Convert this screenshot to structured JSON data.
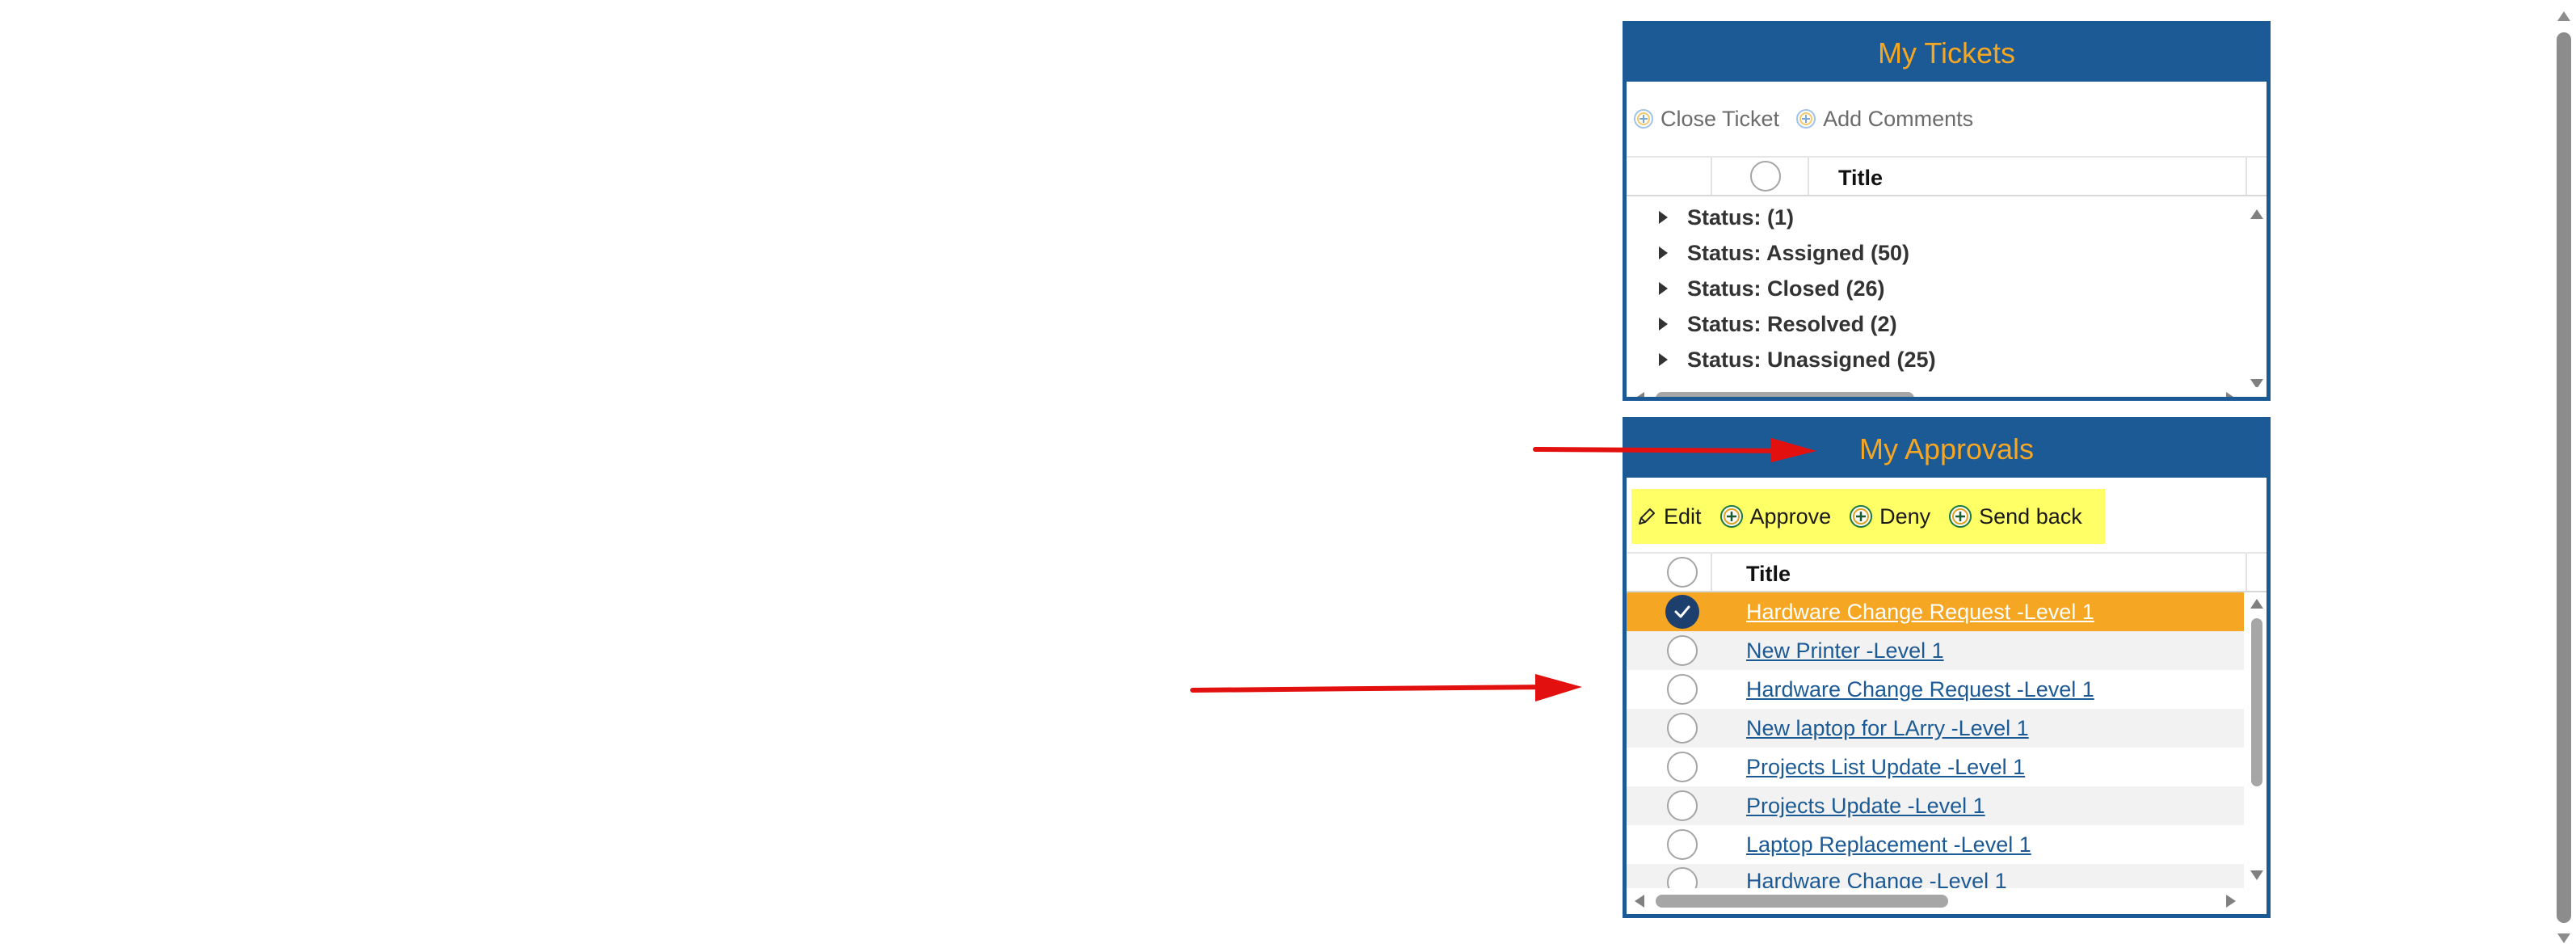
{
  "tickets": {
    "title": "My Tickets",
    "toolbar": [
      {
        "label": "Close Ticket",
        "icon": "add-circle-icon"
      },
      {
        "label": "Add Comments",
        "icon": "add-circle-icon"
      }
    ],
    "column_title": "Title",
    "groups": [
      {
        "label": "Status: (1)"
      },
      {
        "label": "Status: Assigned (50)"
      },
      {
        "label": "Status: Closed (26)"
      },
      {
        "label": "Status: Resolved (2)"
      },
      {
        "label": "Status: Unassigned (25)"
      }
    ]
  },
  "approvals": {
    "title": "My Approvals",
    "toolbar": [
      {
        "label": "Edit",
        "icon": "pencil-icon"
      },
      {
        "label": "Approve",
        "icon": "add-circle-icon"
      },
      {
        "label": "Deny",
        "icon": "add-circle-icon"
      },
      {
        "label": "Send back",
        "icon": "add-circle-icon"
      }
    ],
    "column_title": "Title",
    "rows": [
      {
        "title": "Hardware Change Request -Level 1",
        "selected": true
      },
      {
        "title": "New Printer -Level 1",
        "selected": false
      },
      {
        "title": "Hardware Change Request -Level 1",
        "selected": false
      },
      {
        "title": "New laptop for LArry -Level 1",
        "selected": false
      },
      {
        "title": "Projects List Update -Level 1",
        "selected": false
      },
      {
        "title": "Projects Update -Level 1",
        "selected": false
      },
      {
        "title": "Laptop Replacement -Level 1",
        "selected": false
      },
      {
        "title": "Hardware Change -Level 1",
        "selected": false
      }
    ]
  },
  "colors": {
    "panel_blue": "#1c5a96",
    "header_text": "#f5a623",
    "selected_row": "#f5a623",
    "toolbar_highlight": "#ffff66",
    "annotation_arrow": "#e31010"
  }
}
